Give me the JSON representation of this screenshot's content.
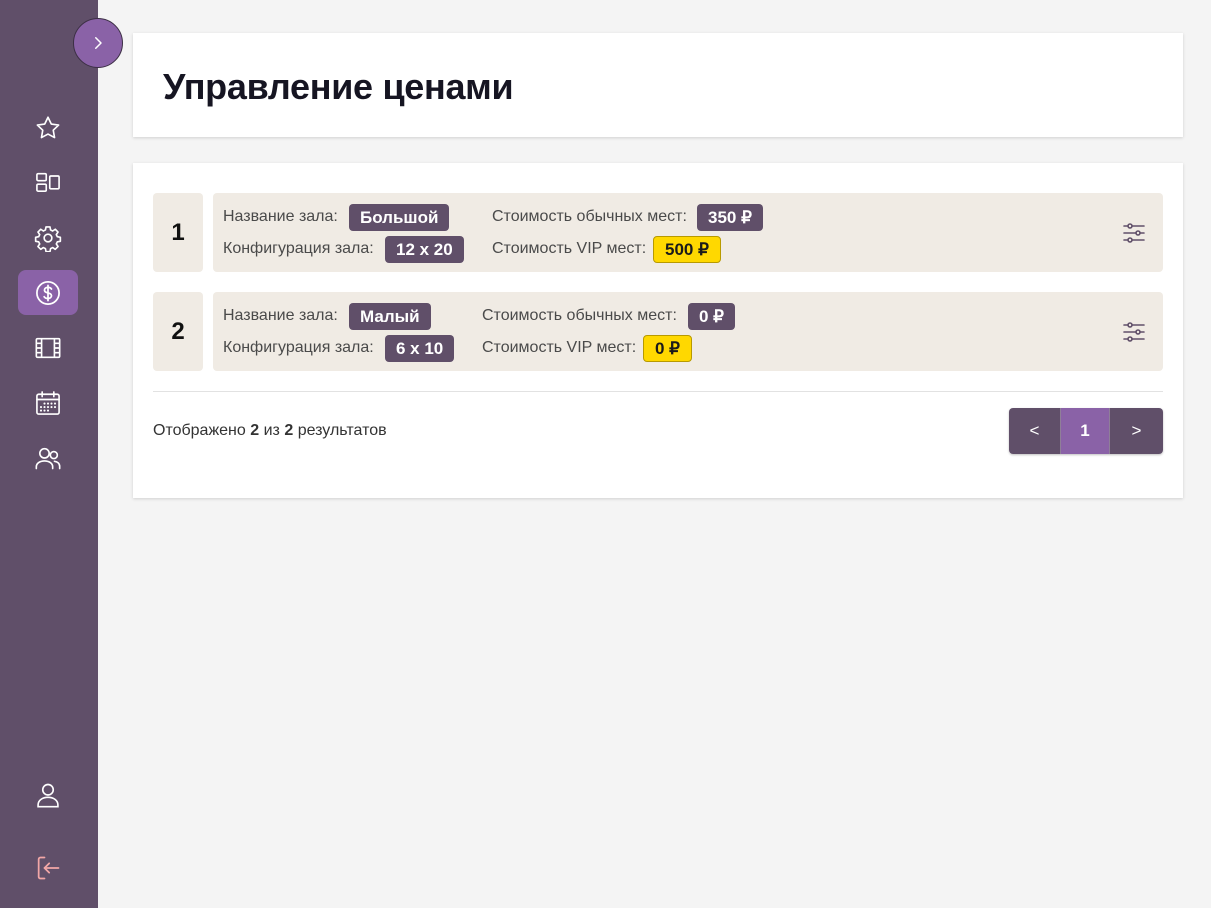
{
  "sidebar": {
    "toggle_icon": "chevron-right-icon",
    "items": [
      {
        "name": "favorites",
        "icon": "star-icon",
        "active": false
      },
      {
        "name": "halls",
        "icon": "layout-icon",
        "active": false
      },
      {
        "name": "settings",
        "icon": "gear-icon",
        "active": false
      },
      {
        "name": "prices",
        "icon": "dollar-icon",
        "active": true
      },
      {
        "name": "movies",
        "icon": "film-icon",
        "active": false
      },
      {
        "name": "schedule",
        "icon": "calendar-icon",
        "active": false
      },
      {
        "name": "users",
        "icon": "users-icon",
        "active": false
      }
    ],
    "bottom": [
      {
        "name": "profile",
        "icon": "user-icon"
      },
      {
        "name": "logout",
        "icon": "logout-icon",
        "color": "#f2a7a7"
      }
    ]
  },
  "page": {
    "title": "Управление ценами"
  },
  "labels": {
    "hall_name": "Название зала:",
    "hall_config": "Конфигурация зала:",
    "regular_price": "Стоимость обычных мест:",
    "vip_price": "Стоимость VIP мест:"
  },
  "halls": [
    {
      "index": "1",
      "name": "Большой",
      "config": "12 x 20",
      "regular_price": "350 ₽",
      "vip_price": "500 ₽"
    },
    {
      "index": "2",
      "name": "Малый",
      "config": "6 x 10",
      "regular_price": "0 ₽",
      "vip_price": "0 ₽"
    }
  ],
  "results": {
    "prefix": "Отображено",
    "shown": "2",
    "middle": "из",
    "total": "2",
    "suffix": "результатов"
  },
  "pagination": {
    "prev": "<",
    "current": "1",
    "next": ">"
  },
  "colors": {
    "sidebar": "#604f69",
    "accent": "#8a62a7",
    "badge": "#604f69",
    "vip_badge": "#ffd800",
    "row_bg": "#f0ebe4",
    "background": "#f4f4f4"
  }
}
